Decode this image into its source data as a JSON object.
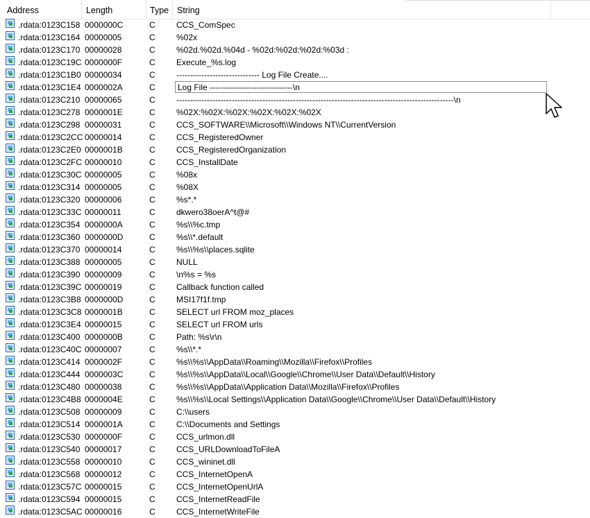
{
  "columns": {
    "address": "Address",
    "length": "Length",
    "type": "Type",
    "string": "String"
  },
  "selected_index": 5,
  "rows": [
    {
      "address": ".rdata:0123C158",
      "length": "0000000C",
      "type": "C",
      "string": "CCS_ComSpec"
    },
    {
      "address": ".rdata:0123C164",
      "length": "00000005",
      "type": "C",
      "string": "%02x"
    },
    {
      "address": ".rdata:0123C170",
      "length": "00000028",
      "type": "C",
      "string": "%02d.%02d.%04d - %02d:%02d:%02d:%03d :"
    },
    {
      "address": ".rdata:0123C19C",
      "length": "0000000F",
      "type": "C",
      "string": "Execute_%s.log"
    },
    {
      "address": ".rdata:0123C1B0",
      "length": "00000034",
      "type": "C",
      "string": "------------------------------ Log File Create...."
    },
    {
      "address": ".rdata:0123C1E4",
      "length": "0000002A",
      "type": "C",
      "string": "Log File ------------------------------\\n"
    },
    {
      "address": ".rdata:0123C210",
      "length": "00000065",
      "type": "C",
      "string": "----------------------------------------------------------------------------------------------------\\n"
    },
    {
      "address": ".rdata:0123C278",
      "length": "0000001E",
      "type": "C",
      "string": "%02X:%02X:%02X:%02X:%02X:%02X"
    },
    {
      "address": ".rdata:0123C298",
      "length": "00000031",
      "type": "C",
      "string": "CCS_SOFTWARE\\\\Microsoft\\\\Windows NT\\\\CurrentVersion"
    },
    {
      "address": ".rdata:0123C2CC",
      "length": "00000014",
      "type": "C",
      "string": "CCS_RegisteredOwner"
    },
    {
      "address": ".rdata:0123C2E0",
      "length": "0000001B",
      "type": "C",
      "string": "CCS_RegisteredOrganization"
    },
    {
      "address": ".rdata:0123C2FC",
      "length": "00000010",
      "type": "C",
      "string": "CCS_InstallDate"
    },
    {
      "address": ".rdata:0123C30C",
      "length": "00000005",
      "type": "C",
      "string": "%08x"
    },
    {
      "address": ".rdata:0123C314",
      "length": "00000005",
      "type": "C",
      "string": "%08X"
    },
    {
      "address": ".rdata:0123C320",
      "length": "00000006",
      "type": "C",
      "string": "%s*.*"
    },
    {
      "address": ".rdata:0123C33C",
      "length": "00000011",
      "type": "C",
      "string": "dkwero38oerA^t@#"
    },
    {
      "address": ".rdata:0123C354",
      "length": "0000000A",
      "type": "C",
      "string": "%s\\\\%c.tmp"
    },
    {
      "address": ".rdata:0123C360",
      "length": "0000000D",
      "type": "C",
      "string": "%s\\\\*.default"
    },
    {
      "address": ".rdata:0123C370",
      "length": "00000014",
      "type": "C",
      "string": "%s\\\\%s\\\\places.sqlite"
    },
    {
      "address": ".rdata:0123C388",
      "length": "00000005",
      "type": "C",
      "string": "NULL"
    },
    {
      "address": ".rdata:0123C390",
      "length": "00000009",
      "type": "C",
      "string": "\\n%s = %s"
    },
    {
      "address": ".rdata:0123C39C",
      "length": "00000019",
      "type": "C",
      "string": "Callback function called"
    },
    {
      "address": ".rdata:0123C3B8",
      "length": "0000000D",
      "type": "C",
      "string": "MSI17f1f.tmp"
    },
    {
      "address": ".rdata:0123C3C8",
      "length": "0000001B",
      "type": "C",
      "string": "SELECT url FROM moz_places"
    },
    {
      "address": ".rdata:0123C3E4",
      "length": "00000015",
      "type": "C",
      "string": "SELECT url FROM urls"
    },
    {
      "address": ".rdata:0123C400",
      "length": "0000000B",
      "type": "C",
      "string": "Path: %s\\r\\n"
    },
    {
      "address": ".rdata:0123C40C",
      "length": "00000007",
      "type": "C",
      "string": "%s\\\\*.*"
    },
    {
      "address": ".rdata:0123C414",
      "length": "0000002F",
      "type": "C",
      "string": "%s\\\\%s\\\\AppData\\\\Roaming\\\\Mozilla\\\\Firefox\\\\Profiles"
    },
    {
      "address": ".rdata:0123C444",
      "length": "0000003C",
      "type": "C",
      "string": "%s\\\\%s\\\\AppData\\\\Local\\\\Google\\\\Chrome\\\\User Data\\\\Default\\\\History"
    },
    {
      "address": ".rdata:0123C480",
      "length": "00000038",
      "type": "C",
      "string": "%s\\\\%s\\\\AppData\\\\Application Data\\\\Mozilla\\\\Firefox\\\\Profiles"
    },
    {
      "address": ".rdata:0123C4B8",
      "length": "0000004E",
      "type": "C",
      "string": "%s\\\\%s\\\\Local Settings\\\\Application Data\\\\Google\\\\Chrome\\\\User Data\\\\Default\\\\History"
    },
    {
      "address": ".rdata:0123C508",
      "length": "00000009",
      "type": "C",
      "string": "C:\\\\users"
    },
    {
      "address": ".rdata:0123C514",
      "length": "0000001A",
      "type": "C",
      "string": "C:\\\\Documents and Settings"
    },
    {
      "address": ".rdata:0123C530",
      "length": "0000000F",
      "type": "C",
      "string": "CCS_urlmon.dll"
    },
    {
      "address": ".rdata:0123C540",
      "length": "00000017",
      "type": "C",
      "string": "CCS_URLDownloadToFileA"
    },
    {
      "address": ".rdata:0123C558",
      "length": "00000010",
      "type": "C",
      "string": "CCS_wininet.dll"
    },
    {
      "address": ".rdata:0123C568",
      "length": "00000012",
      "type": "C",
      "string": "CCS_InternetOpenA"
    },
    {
      "address": ".rdata:0123C57C",
      "length": "00000015",
      "type": "C",
      "string": "CCS_InternetOpenUrlA"
    },
    {
      "address": ".rdata:0123C594",
      "length": "00000015",
      "type": "C",
      "string": "CCS_InternetReadFile"
    },
    {
      "address": ".rdata:0123C5AC",
      "length": "00000016",
      "type": "C",
      "string": "CCS_InternetWriteFile"
    }
  ]
}
